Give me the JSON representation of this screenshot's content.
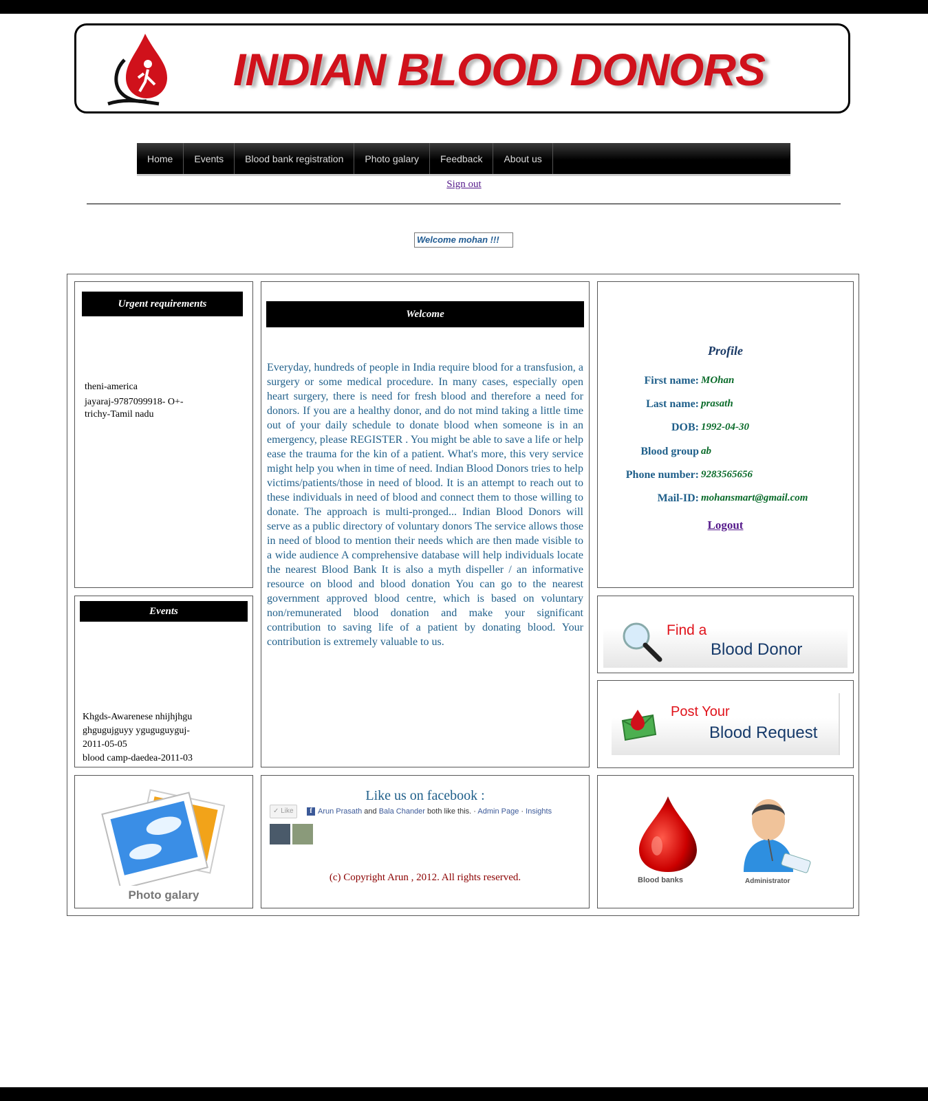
{
  "header": {
    "brand": "INDIAN BLOOD DONORS"
  },
  "nav": {
    "items": [
      "Home",
      "Events",
      "Blood bank registration",
      "Photo galary",
      "Feedback",
      "About us"
    ],
    "sign_out": "Sign out"
  },
  "welcome_user": "Welcome mohan !!!",
  "urgent": {
    "title": "Urgent requirements",
    "lines": [
      "theni-america",
      "jayaraj-9787099918- O+-",
      "trichy-Tamil nadu"
    ]
  },
  "events": {
    "title": "Events",
    "lines": [
      "Khgds-Awarenese nhijhjhgu",
      "ghgugujguyy yguguguyguj-",
      "2011-05-05",
      "blood camp-daedea-2011-03"
    ]
  },
  "welcome": {
    "title": "Welcome",
    "text": "Everyday, hundreds of people in India require blood for a transfusion, a surgery or some medical procedure. In many cases, especially open heart surgery, there is need for fresh blood and therefore a need for donors. If you are a healthy donor, and do not mind taking a little time out of your daily schedule to donate blood when someone is in an emergency, please REGISTER . You might be able to save a life or help ease the trauma for the kin of a patient. What's more, this very service might help you when in time of need. Indian Blood Donors tries to help victims/patients/those in need of blood. It is an attempt to reach out to these individuals in need of blood and connect them to those willing to donate. The approach is multi-pronged... Indian Blood Donors will serve as a public directory of voluntary donors The service allows those in need of blood to mention their needs which are then made visible to a wide audience A comprehensive database will help individuals locate the nearest Blood Bank It is also a myth dispeller / an informative resource on blood and blood donation You can go to the nearest government approved blood centre, which is based on voluntary non/remunerated blood donation and make your significant contribution to saving life of a patient by donating blood. Your contribution is extremely valuable to us."
  },
  "profile": {
    "title": "Profile",
    "first_name_label": "First name:",
    "first_name": "MOhan",
    "last_name_label": "Last name:",
    "last_name": "prasath",
    "dob_label": "DOB:",
    "dob": "1992-04-30",
    "blood_group_label": "Blood group",
    "blood_group": "ab",
    "phone_label": "Phone number:",
    "phone": "9283565656",
    "mail_label": "Mail-ID:",
    "mail": "mohansmart@gmail.com",
    "logout": "Logout"
  },
  "find_donor": {
    "line1": "Find a",
    "line2": "Blood Donor"
  },
  "post_request": {
    "line1": "Post Your",
    "line2": "Blood Request"
  },
  "photo_gallery": {
    "label": "Photo galary"
  },
  "facebook": {
    "title": "Like us on facebook :",
    "like_button": "Like",
    "name1": "Arun Prasath",
    "and": "and",
    "name2": "Bala Chander",
    "like_text": "both like this.",
    "admin_page": "Admin Page",
    "insights": "Insights",
    "separator": "·",
    "copyright": "(c) Copyright Arun , 2012. All rights reserved."
  },
  "blood_banks": {
    "label": "Blood banks"
  },
  "administrator": {
    "label": "Administrator"
  },
  "colors": {
    "brand_red": "#d0111b",
    "link_purple": "#551a8b",
    "text_blue": "#1f5f8a",
    "value_green": "#0a6b2a"
  }
}
